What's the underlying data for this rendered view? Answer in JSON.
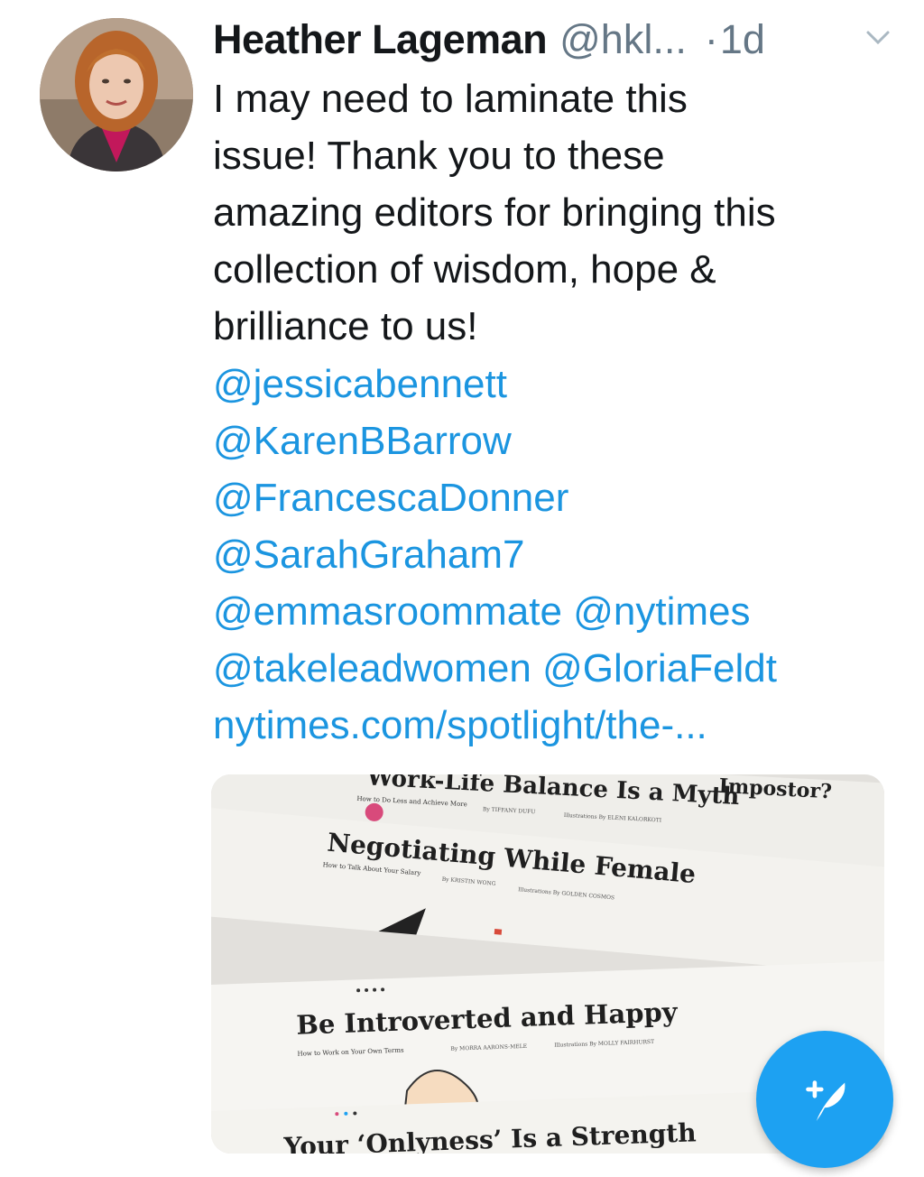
{
  "tweet": {
    "author_name": "Heather Lageman",
    "author_handle": "@hkl...",
    "separator": "·",
    "time": "1d",
    "text": "I may need to laminate this\nissue!  Thank you to these\namazing editors for bringing this\ncollection of wisdom, hope &\nbrilliance to us!",
    "mentions": [
      [
        "@jessicabennett"
      ],
      [
        "@KarenBBarrow"
      ],
      [
        "@FrancescaDonner"
      ],
      [
        "@SarahGraham7"
      ],
      [
        "@emmasroommate",
        "@nytimes"
      ],
      [
        "@takeleadwomen",
        "@GloriaFeldt"
      ]
    ],
    "link": "nytimes.com/spotlight/the-..."
  },
  "media": {
    "headlines": {
      "h1": "Work-Life Balance Is a Myth",
      "h1_sub": "How to Do Less and Achieve More",
      "h1_by": "By TIFFANY DUFU",
      "h1_ill": "Illustrations By ELENI KALORKOTI",
      "top_partial": "Impostor?",
      "h2": "Negotiating While Female",
      "h2_sub": "How to Talk About Your Salary",
      "h2_by": "By KRISTIN WONG",
      "h2_ill": "Illustrations By GOLDEN COSMOS",
      "h3": "Be Introverted and Happy",
      "h3_sub": "How to Work on Your Own Terms",
      "h3_by": "By MORRA AARONS-MELE",
      "h3_ill": "Illustrations By MOLLY FAIRHURST",
      "h4": "Your ‘Onlyness’ Is a Strength"
    }
  },
  "colors": {
    "link": "#1b95e0",
    "muted": "#657786",
    "text": "#14171a",
    "fab": "#1da1f2"
  },
  "icons": {
    "caret": "chevron-down-icon",
    "compose": "compose-tweet-icon"
  }
}
